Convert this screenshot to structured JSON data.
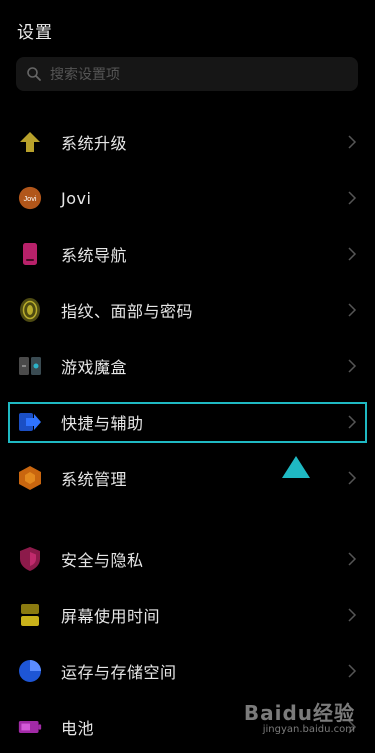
{
  "header": {
    "title": "设置"
  },
  "search": {
    "placeholder": "搜索设置项"
  },
  "items": [
    {
      "label": "系统升级",
      "icon": "upgrade-arrow-icon"
    },
    {
      "label": "Jovi",
      "icon": "jovi-icon",
      "icon_text": "Jovi"
    },
    {
      "label": "系统导航",
      "icon": "phone-navigation-icon"
    },
    {
      "label": "指纹、面部与密码",
      "icon": "fingerprint-icon"
    },
    {
      "label": "游戏魔盒",
      "icon": "game-box-icon"
    },
    {
      "label": "快捷与辅助",
      "icon": "shortcut-arrow-icon"
    },
    {
      "label": "系统管理",
      "icon": "system-management-hexagon-icon"
    },
    {
      "label": "安全与隐私",
      "icon": "security-shield-icon"
    },
    {
      "label": "屏幕使用时间",
      "icon": "screen-time-hourglass-icon"
    },
    {
      "label": "运存与存储空间",
      "icon": "storage-pie-icon"
    },
    {
      "label": "电池",
      "icon": "battery-icon"
    }
  ],
  "highlighted_item": "快捷与辅助",
  "colors": {
    "highlight": "#1fb9c3",
    "background": "#000000"
  },
  "watermark": {
    "brand": "Baidu经验",
    "url": "jingyan.baidu.com"
  }
}
